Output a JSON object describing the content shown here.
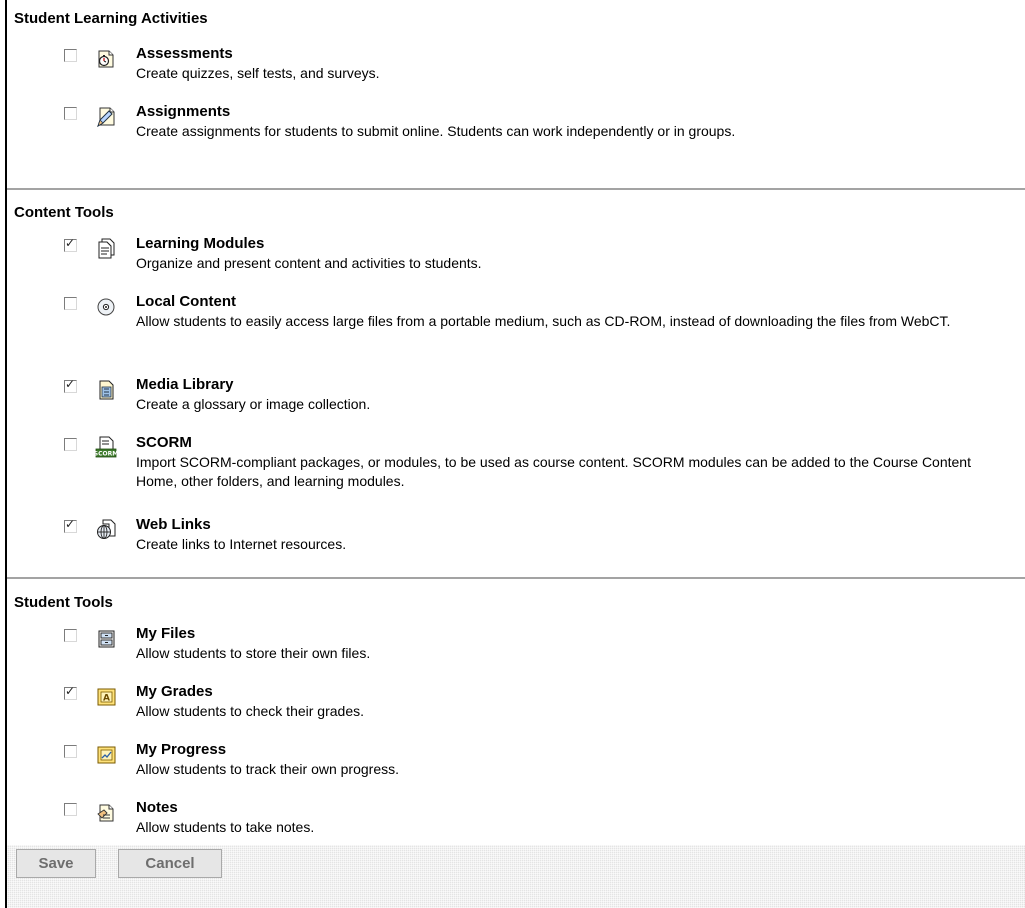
{
  "sections": [
    {
      "title": "Student Learning Activities",
      "tools": [
        {
          "name": "Assessments",
          "desc": "Create quizzes, self tests, and surveys.",
          "checked": false,
          "icon": "assessment-stopwatch-icon"
        },
        {
          "name": "Assignments",
          "desc": "Create assignments for students to submit online. Students can work independently or in groups.",
          "checked": false,
          "icon": "assignment-pencil-icon"
        }
      ]
    },
    {
      "title": "Content Tools",
      "tools": [
        {
          "name": "Learning Modules",
          "desc": "Organize and present content and activities to students.",
          "checked": true,
          "icon": "learning-module-document-icon"
        },
        {
          "name": "Local Content",
          "desc": "Allow students to easily access large files from a portable medium, such as CD-ROM, instead of downloading the files from WebCT.",
          "checked": false,
          "icon": "cd-rom-icon"
        },
        {
          "name": "Media Library",
          "desc": "Create a glossary or image collection.",
          "checked": true,
          "icon": "media-library-icon"
        },
        {
          "name": "SCORM",
          "desc": "Import SCORM-compliant packages, or modules, to be used as course content. SCORM modules can be added to the Course Content Home, other folders, and learning modules.",
          "checked": false,
          "icon": "scorm-package-icon"
        },
        {
          "name": "Web Links",
          "desc": "Create links to Internet resources.",
          "checked": true,
          "icon": "globe-link-icon"
        }
      ]
    },
    {
      "title": "Student Tools",
      "tools": [
        {
          "name": "My Files",
          "desc": "Allow students to store their own files.",
          "checked": false,
          "icon": "file-cabinet-icon"
        },
        {
          "name": "My Grades",
          "desc": "Allow students to check their grades.",
          "checked": true,
          "icon": "grade-a-icon"
        },
        {
          "name": "My Progress",
          "desc": "Allow students to track their own progress.",
          "checked": false,
          "icon": "progress-chart-icon"
        },
        {
          "name": "Notes",
          "desc": "Allow students to take notes.",
          "checked": false,
          "icon": "notes-pencil-icon"
        }
      ]
    }
  ],
  "footer": {
    "save_label": "Save",
    "cancel_label": "Cancel"
  }
}
